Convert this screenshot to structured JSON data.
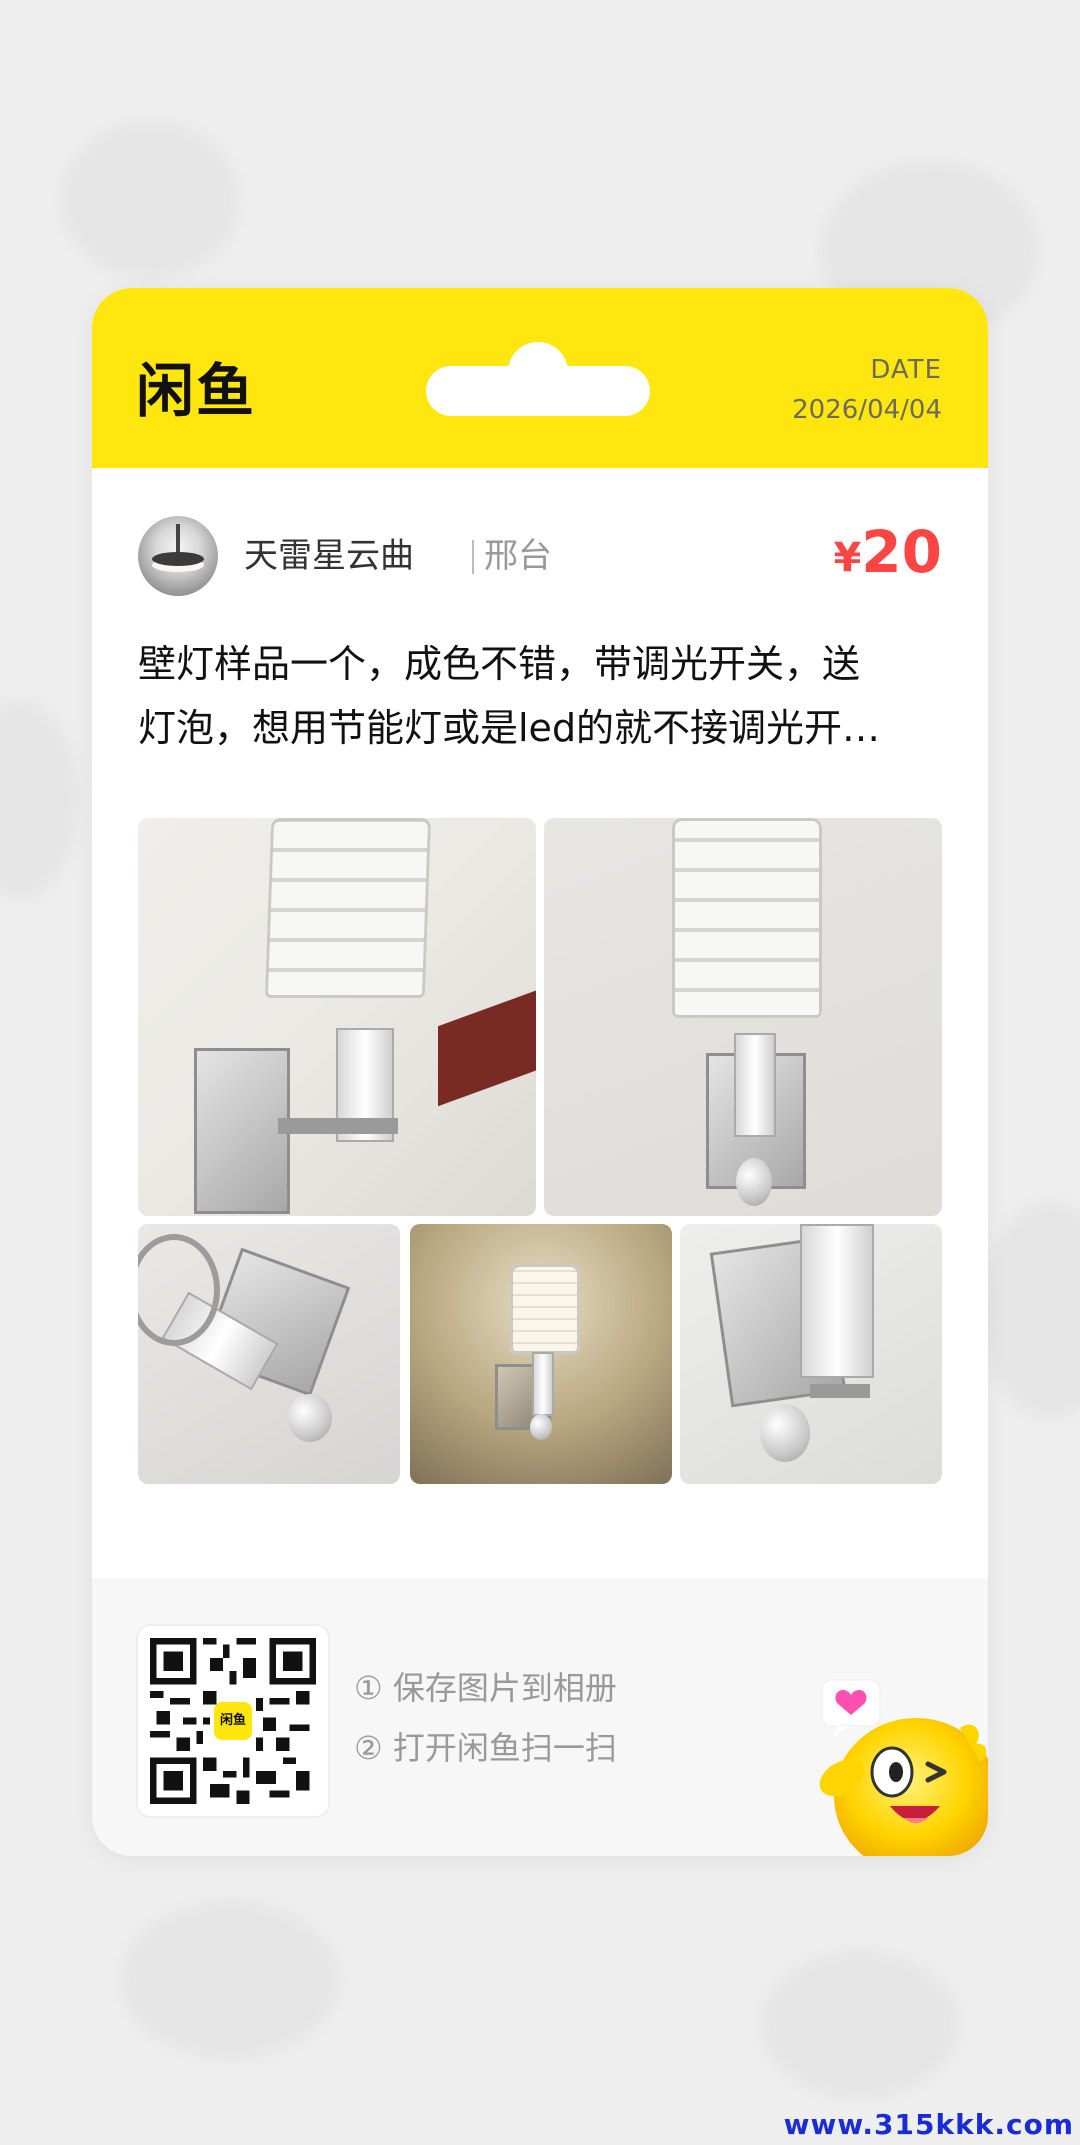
{
  "app": {
    "logo": "闲鱼"
  },
  "header": {
    "date_label": "DATE",
    "date_value": "2026/04/04"
  },
  "seller": {
    "name": "天雷星云曲",
    "city": "邢台"
  },
  "price": {
    "symbol": "¥",
    "value": "20"
  },
  "description": {
    "line1": "壁灯样品一个，成色不错，带调光开关，送",
    "line2": "灯泡，想用节能灯或是led的就不接调光开…"
  },
  "photos": [
    {
      "alt": "wall-lamp-photo"
    },
    {
      "alt": "wall-lamp-photo"
    },
    {
      "alt": "wall-lamp-photo"
    },
    {
      "alt": "wall-lamp-photo"
    },
    {
      "alt": "wall-lamp-photo"
    }
  ],
  "footer": {
    "qr_badge": "闲鱼",
    "step1": "① 保存图片到相册",
    "step2": "② 打开闲鱼扫一扫"
  },
  "watermark": "www.315kkk.com",
  "colors": {
    "brand_yellow": "#ffe60f",
    "price_red": "#ff4444"
  }
}
